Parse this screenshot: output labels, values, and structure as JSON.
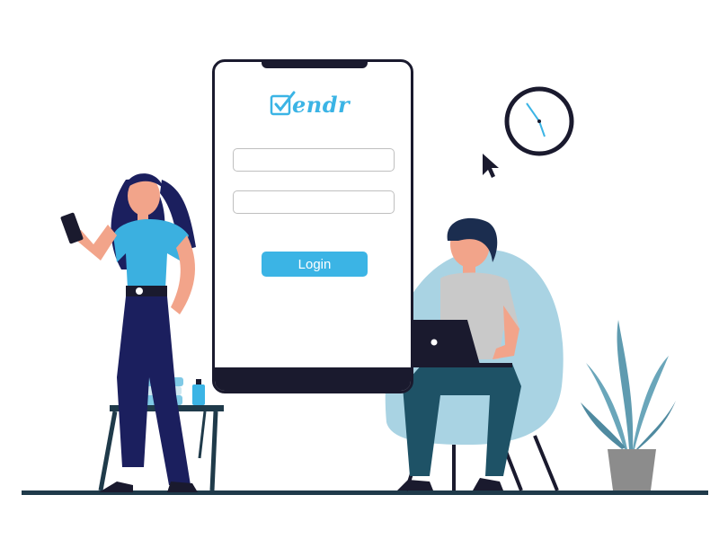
{
  "app": {
    "logo_text": "endr"
  },
  "login_form": {
    "username_value": "",
    "password_value": "",
    "login_label": "Login"
  },
  "icons": {
    "logo": "checkbox-check-icon",
    "cursor": "mouse-pointer-icon",
    "clock": "wall-clock-icon"
  },
  "colors": {
    "accent": "#3bb4e5",
    "dark": "#1a1a2e",
    "woman_shirt": "#3bb0e0",
    "woman_pants": "#1b1f5e",
    "chair": "#a9d3e3",
    "man_pants": "#1e5266",
    "plant": "#5f9bb0",
    "pot": "#8c8c8c",
    "floor": "#1f3a4a"
  }
}
